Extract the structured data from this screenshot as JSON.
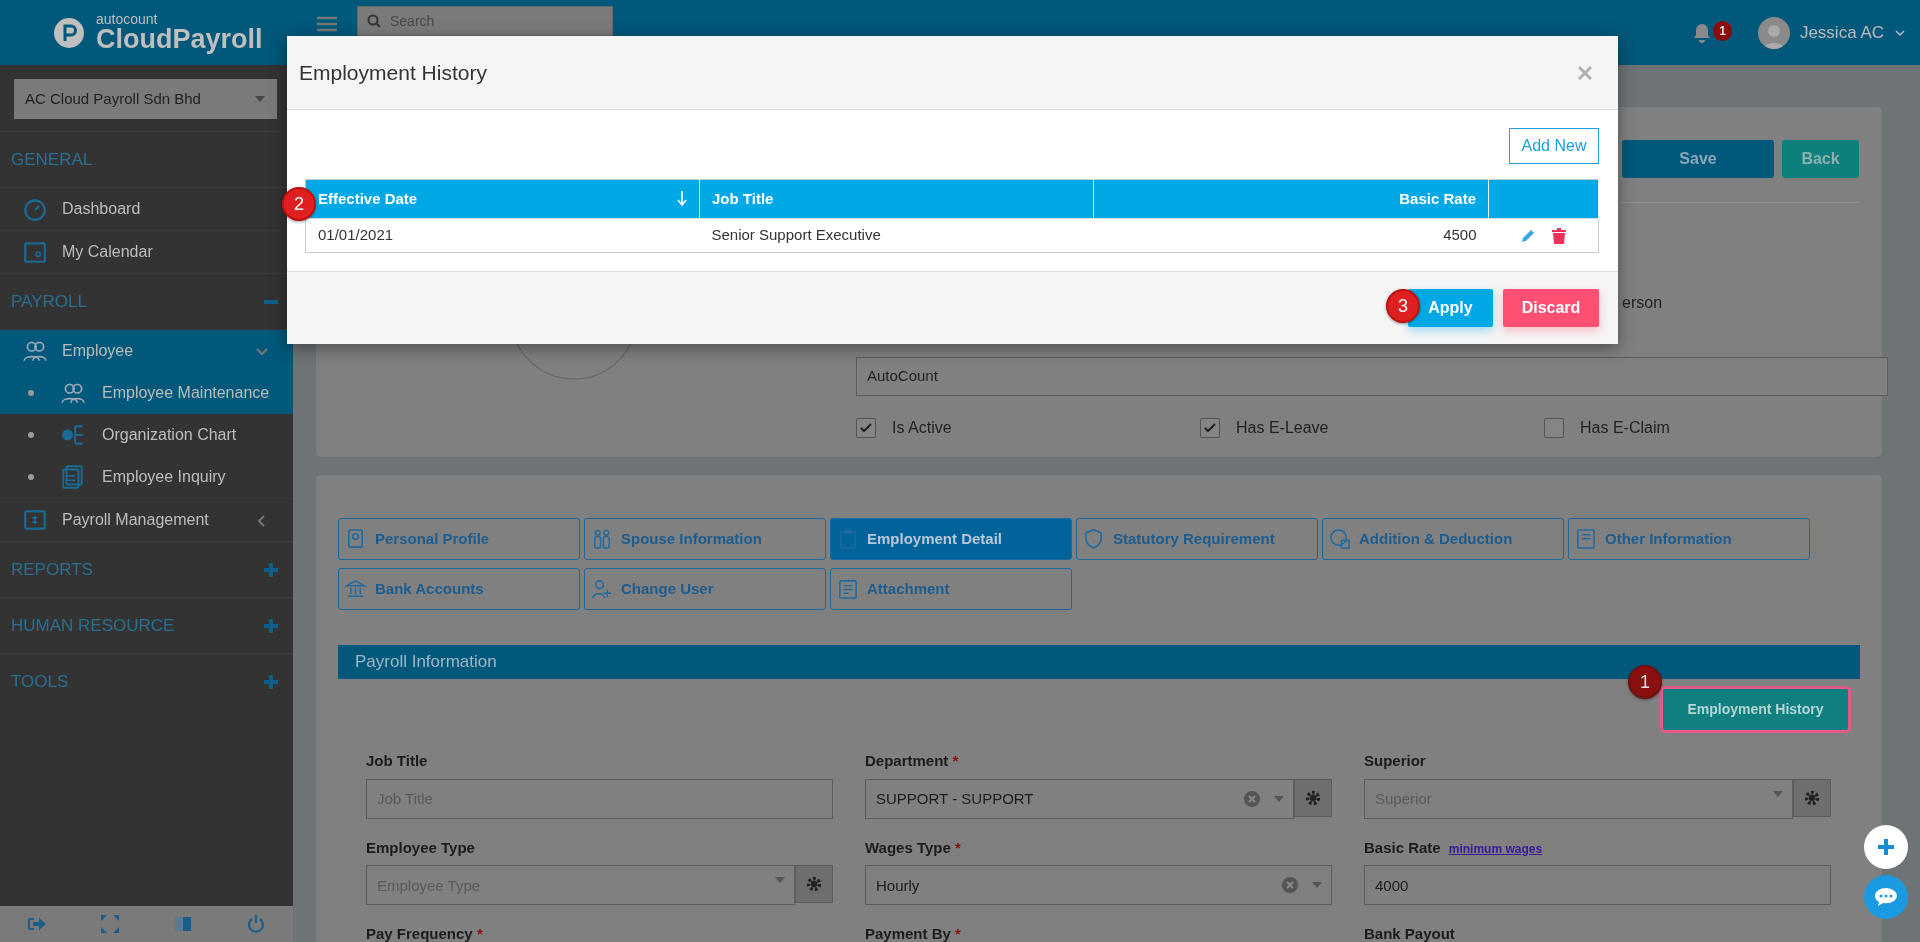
{
  "header": {
    "logo": {
      "brand": "autocount",
      "product": "CloudPayroll"
    },
    "search": {
      "placeholder": "Search"
    },
    "notification_count": "1",
    "user": "Jessica AC"
  },
  "sidebar": {
    "company": "AC Cloud Payroll Sdn Bhd",
    "sections": [
      {
        "label": "GENERAL",
        "kind": "fixed",
        "items": [
          {
            "label": "Dashboard",
            "kind": "link",
            "selected": false
          },
          {
            "label": "My Calendar",
            "kind": "link",
            "selected": false
          }
        ]
      },
      {
        "label": "PAYROLL",
        "kind": "collapsible",
        "expanded": true,
        "items": [
          {
            "label": "Employee",
            "kind": "group",
            "selected": true,
            "expanded": true,
            "children": [
              {
                "label": "Employee Maintenance",
                "selected": true
              },
              {
                "label": "Organization Chart",
                "selected": false
              },
              {
                "label": "Employee Inquiry",
                "selected": false
              }
            ]
          },
          {
            "label": "Payroll Management",
            "kind": "group",
            "selected": false,
            "expanded": false
          }
        ]
      },
      {
        "label": "REPORTS",
        "kind": "collapsible",
        "expanded": false
      },
      {
        "label": "HUMAN RESOURCE",
        "kind": "collapsible",
        "expanded": false
      },
      {
        "label": "TOOLS",
        "kind": "collapsible",
        "expanded": false
      }
    ]
  },
  "profile": {
    "buttons": [
      {
        "label": "Save",
        "kind": "primary"
      },
      {
        "label": "Back",
        "kind": "secondary"
      }
    ],
    "partial_label": "erson",
    "company_field": {
      "value": "AutoCount"
    },
    "checkboxes": [
      {
        "label": "Is Active",
        "checked": true
      },
      {
        "label": "Has E-Leave",
        "checked": true
      },
      {
        "label": "Has E-Claim",
        "checked": false
      }
    ]
  },
  "tabs": [
    {
      "label": "Personal Profile",
      "selected": false
    },
    {
      "label": "Spouse Information",
      "selected": false
    },
    {
      "label": "Employment Detail",
      "selected": true
    },
    {
      "label": "Statutory Requirement",
      "selected": false
    },
    {
      "label": "Addition & Deduction",
      "selected": false
    },
    {
      "label": "Other Information",
      "selected": false
    },
    {
      "label": "Bank Accounts",
      "selected": false
    },
    {
      "label": "Change User",
      "selected": false
    },
    {
      "label": "Attachment",
      "selected": false
    }
  ],
  "payroll_section": {
    "title": "Payroll Information",
    "history_button": {
      "label": "Employment History",
      "callout": "1"
    },
    "fields": [
      {
        "label": "Job Title",
        "kind": "text",
        "placeholder": "Job Title"
      },
      {
        "label": "Department",
        "required_mark": "*",
        "kind": "select",
        "value": "SUPPORT - SUPPORT",
        "clearable": true,
        "settings": true
      },
      {
        "label": "Superior",
        "kind": "select",
        "placeholder": "Superior",
        "clearable": false,
        "settings": true
      },
      {
        "label": "Employee Type",
        "kind": "select",
        "placeholder": "Employee Type",
        "clearable": false,
        "settings": true
      },
      {
        "label": "Wages Type",
        "required_mark": "*",
        "kind": "select",
        "value": "Hourly",
        "clearable": true,
        "settings": false
      },
      {
        "label": "Basic Rate",
        "kind": "text",
        "value": "4000",
        "link": "minimum wages"
      },
      {
        "label": "Pay Frequency",
        "required_mark": "*",
        "kind": "cut"
      },
      {
        "label": "Payment By",
        "required_mark": "*",
        "kind": "cut"
      },
      {
        "label": "Bank Payout",
        "kind": "cut"
      }
    ]
  },
  "modal": {
    "title": "Employment History",
    "add_button": "Add New",
    "table": {
      "callout": "2",
      "columns": [
        {
          "label": "Effective Date",
          "kind": "text",
          "sorted": true
        },
        {
          "label": "Job Title",
          "kind": "text",
          "sorted": false
        },
        {
          "label": "Basic Rate",
          "kind": "number",
          "sorted": false
        }
      ],
      "rows": [
        {
          "cells": [
            "01/01/2021",
            "Senior Support Executive",
            "4500"
          ]
        }
      ]
    },
    "buttons": [
      {
        "label": "Apply",
        "kind": "primary",
        "callout": "3"
      },
      {
        "label": "Discard",
        "kind": "danger"
      }
    ]
  }
}
